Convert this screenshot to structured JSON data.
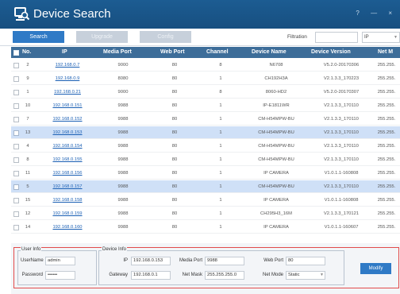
{
  "app": {
    "title": "Device Search",
    "window_controls": "? — ×"
  },
  "toolbar": {
    "tabs": [
      {
        "label": "Search",
        "active": true
      },
      {
        "label": "Upgrade",
        "active": false
      },
      {
        "label": "Config",
        "active": false
      }
    ],
    "filtration_label": "Filtration",
    "filtration_value": "",
    "filter_type": "IP"
  },
  "table": {
    "headers": [
      "No.",
      "IP",
      "Media Port",
      "Web Port",
      "Channel",
      "Device Name",
      "Device Version",
      "Net M"
    ],
    "rows": [
      {
        "no": "2",
        "ip": "192.168.0.7",
        "media": "9000",
        "web": "80",
        "channel": "8",
        "name": "N6708",
        "version": "V5.2.0-20170306",
        "mask": "255.255.",
        "selected": false
      },
      {
        "no": "9",
        "ip": "192.168.0.9",
        "media": "8080",
        "web": "80",
        "channel": "1",
        "name": "CH192H3A",
        "version": "V2.1.3.3_170223",
        "mask": "255.255.",
        "selected": false
      },
      {
        "no": "1",
        "ip": "192.168.0.21",
        "media": "9000",
        "web": "80",
        "channel": "8",
        "name": "8060-HD2",
        "version": "V5.2.0-20170307",
        "mask": "255.255.",
        "selected": false
      },
      {
        "no": "10",
        "ip": "192.168.0.151",
        "media": "9988",
        "web": "80",
        "channel": "1",
        "name": "IP-E1811WR",
        "version": "V2.1.3.3_170110",
        "mask": "255.255.",
        "selected": false
      },
      {
        "no": "7",
        "ip": "192.168.0.152",
        "media": "9988",
        "web": "80",
        "channel": "1",
        "name": "CM-H54MPW-BU",
        "version": "V2.1.3.3_170110",
        "mask": "255.255.",
        "selected": false
      },
      {
        "no": "13",
        "ip": "192.168.0.153",
        "media": "9988",
        "web": "80",
        "channel": "1",
        "name": "CM-H54MPW-BU",
        "version": "V2.1.3.3_170110",
        "mask": "255.255.",
        "selected": true
      },
      {
        "no": "4",
        "ip": "192.168.0.154",
        "media": "9988",
        "web": "80",
        "channel": "1",
        "name": "CM-H54MPW-BU",
        "version": "V2.1.3.3_170110",
        "mask": "255.255.",
        "selected": false
      },
      {
        "no": "8",
        "ip": "192.168.0.155",
        "media": "9988",
        "web": "80",
        "channel": "1",
        "name": "CM-H54MPW-BU",
        "version": "V2.1.3.3_170110",
        "mask": "255.255.",
        "selected": false
      },
      {
        "no": "11",
        "ip": "192.168.0.156",
        "media": "9988",
        "web": "80",
        "channel": "1",
        "name": "IP CAMERA",
        "version": "V1.0.1.1-160808",
        "mask": "255.255.",
        "selected": false
      },
      {
        "no": "5",
        "ip": "192.168.0.157",
        "media": "9988",
        "web": "80",
        "channel": "1",
        "name": "CM-H54MPW-BU",
        "version": "V2.1.3.3_170110",
        "mask": "255.255.",
        "selected": true
      },
      {
        "no": "15",
        "ip": "192.168.0.158",
        "media": "9988",
        "web": "80",
        "channel": "1",
        "name": "IP CAMERA",
        "version": "V1.0.1.1-160808",
        "mask": "255.255.",
        "selected": false
      },
      {
        "no": "12",
        "ip": "192.168.0.159",
        "media": "9988",
        "web": "80",
        "channel": "1",
        "name": "CH295H3_16M",
        "version": "V2.1.3.3_170121",
        "mask": "255.255.",
        "selected": false
      },
      {
        "no": "14",
        "ip": "192.168.0.160",
        "media": "9988",
        "web": "80",
        "channel": "1",
        "name": "IP CAMERA",
        "version": "V1.0.1.1-160607",
        "mask": "255.255.",
        "selected": false
      }
    ]
  },
  "user_info": {
    "legend": "User Info",
    "username_label": "UserName",
    "username": "admin",
    "password_label": "Password",
    "password": "••••••"
  },
  "device_info": {
    "legend": "Device Info",
    "ip_label": "IP",
    "ip": "192.168.0.153",
    "media_port_label": "Media Port",
    "media_port": "9988",
    "web_port_label": "Web Port",
    "web_port": "80",
    "gateway_label": "Gateway",
    "gateway": "192.168.0.1",
    "net_mask_label": "Net Mask",
    "net_mask": "255.255.255.0",
    "net_mode_label": "Net Mode",
    "net_mode": "Static"
  },
  "actions": {
    "modify_label": "Modify"
  }
}
